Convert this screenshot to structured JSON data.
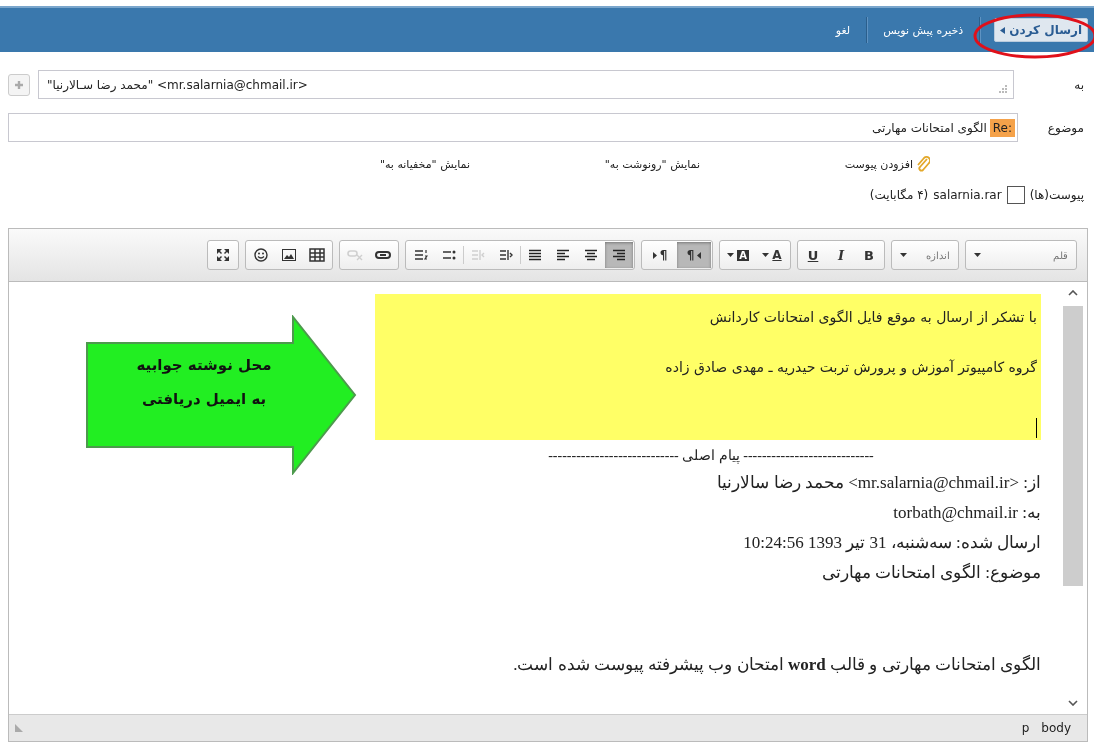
{
  "actions": [
    {
      "label": "ارسال کردن",
      "kind": "primary"
    },
    {
      "label": "ذخیره پیش نویس",
      "kind": "plain"
    },
    {
      "label": "لغو",
      "kind": "plain"
    }
  ],
  "to": {
    "label": "به",
    "value": "\"محمد رضا سـالارنیا\" <mr.salarnia@chmail.ir>"
  },
  "subject": {
    "label": "موضوع",
    "prefix": "Re:",
    "value": "الگوی امتحانات مهارتی"
  },
  "links": [
    {
      "label": "افزودن پیوست",
      "kind": "attach"
    },
    {
      "label": "نمایش \"رونوشت به\"",
      "kind": "plain"
    },
    {
      "label": "نمایش \"مخفیانه به\"",
      "kind": "plain"
    }
  ],
  "attachments": {
    "label": "پیوست(ها)",
    "files": [
      {
        "name": "salarnia.rar",
        "size": "(۴ مگابایت)",
        "checked": false
      }
    ]
  },
  "editor_toolbar": {
    "selects": [
      {
        "label": "قلم"
      },
      {
        "label": "اندازه"
      }
    ],
    "groups": [
      [
        {
          "kind": "bold",
          "label": "B",
          "selected": false,
          "disabled": false
        },
        {
          "kind": "italic",
          "label": "I",
          "selected": false,
          "disabled": false
        },
        {
          "kind": "underline",
          "label": "U",
          "selected": false,
          "disabled": false
        }
      ],
      [
        {
          "kind": "text-color",
          "label": "A",
          "selected": false,
          "disabled": false
        },
        {
          "kind": "bg-color",
          "label": "A",
          "selected": false,
          "disabled": false
        }
      ],
      [
        {
          "kind": "rtl",
          "label": "¶",
          "selected": true,
          "disabled": false
        },
        {
          "kind": "ltr",
          "label": "¶",
          "selected": false,
          "disabled": false
        }
      ],
      [
        {
          "kind": "align-right",
          "selected": true,
          "disabled": false
        },
        {
          "kind": "align-center",
          "selected": false,
          "disabled": false
        },
        {
          "kind": "align-left",
          "selected": false,
          "disabled": false
        },
        {
          "kind": "justify",
          "selected": false,
          "disabled": false
        },
        {
          "kind": "indent",
          "selected": false,
          "disabled": false
        },
        {
          "kind": "outdent",
          "selected": false,
          "disabled": true
        },
        {
          "kind": "bullet-list",
          "selected": false,
          "disabled": false
        },
        {
          "kind": "numbered-list",
          "selected": false,
          "disabled": false
        }
      ],
      [
        {
          "kind": "link",
          "selected": false,
          "disabled": false
        },
        {
          "kind": "unlink",
          "selected": false,
          "disabled": true
        }
      ],
      [
        {
          "kind": "table",
          "selected": false,
          "disabled": false
        },
        {
          "kind": "image",
          "selected": false,
          "disabled": false
        },
        {
          "kind": "emoticon",
          "selected": false,
          "disabled": false
        }
      ],
      [
        {
          "kind": "fullscreen",
          "selected": false,
          "disabled": false
        }
      ]
    ]
  },
  "body": {
    "reply": [
      "با تشکر از ارسال به موقع فایل الگوی امتحانات کاردانش",
      "گروه کامپیوتر آموزش و پرورش تربت حیدریه ـ مهدی صادق زاده"
    ],
    "quoted": [
      "---------------------------- پیام اصلی ----------------------------",
      "از: <mr.salarnia@chmail.ir> محمد رضا سالارنیا",
      "به: torbath@chmail.ir",
      "ارسال شده: سه‌شنبه، 31 تیر 1393 10:24:56",
      "موضوع: الگوی امتحانات مهارتی"
    ],
    "last": "الگوی امتحانات مهارتی و قالب **word** امتحان وب پیشرفته پیوست شده است."
  },
  "callout": [
    "محل نوشته جوابیه",
    "به ایمیل دریافتی"
  ],
  "status_path": [
    "body",
    "p"
  ]
}
